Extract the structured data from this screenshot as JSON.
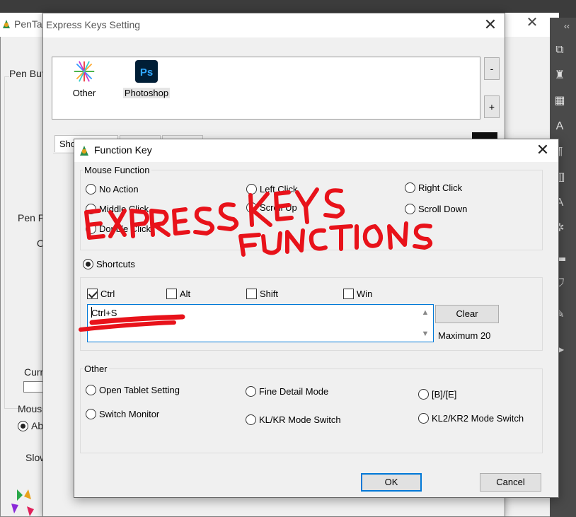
{
  "background_window": {
    "title": "PenTal",
    "labels": [
      "Pen But",
      "Pen P",
      "O",
      "Curr",
      "Mous",
      "Ab",
      "Slow"
    ]
  },
  "express_keys_window": {
    "title": "Express Keys Setting",
    "apps": [
      {
        "label": "Other",
        "icon": "other-app-icon"
      },
      {
        "label": "Photoshop",
        "icon": "photoshop-icon"
      }
    ],
    "remove_button": "-",
    "add_button": "+",
    "tab_partial": "Sho"
  },
  "function_key_dialog": {
    "title": "Function Key",
    "mouse_function": {
      "title": "Mouse Function",
      "options": [
        "No Action",
        "Left Click",
        "Right Click",
        "Middle Click",
        "Scroll Up",
        "Scroll Down",
        "Double Click"
      ]
    },
    "shortcuts": {
      "label": "Shortcuts",
      "selected": true,
      "modifiers": [
        {
          "label": "Ctrl",
          "checked": true
        },
        {
          "label": "Alt",
          "checked": false
        },
        {
          "label": "Shift",
          "checked": false
        },
        {
          "label": "Win",
          "checked": false
        }
      ],
      "value": "Ctrl+S",
      "clear_button": "Clear",
      "maximum_text": "Maximum 20"
    },
    "other": {
      "title": "Other",
      "options": [
        "Open Tablet Setting",
        "Fine Detail Mode",
        "[B]/[E]",
        "Switch Monitor",
        "KL/KR Mode Switch",
        "KL2/KR2 Mode Switch"
      ]
    },
    "ok_button": "OK",
    "cancel_button": "Cancel"
  },
  "annotation": {
    "handwritten_text": "EXPRESS KEYS FUNCTIONS",
    "color": "#e8121a"
  },
  "toolbar_collapse_label": "‹‹"
}
